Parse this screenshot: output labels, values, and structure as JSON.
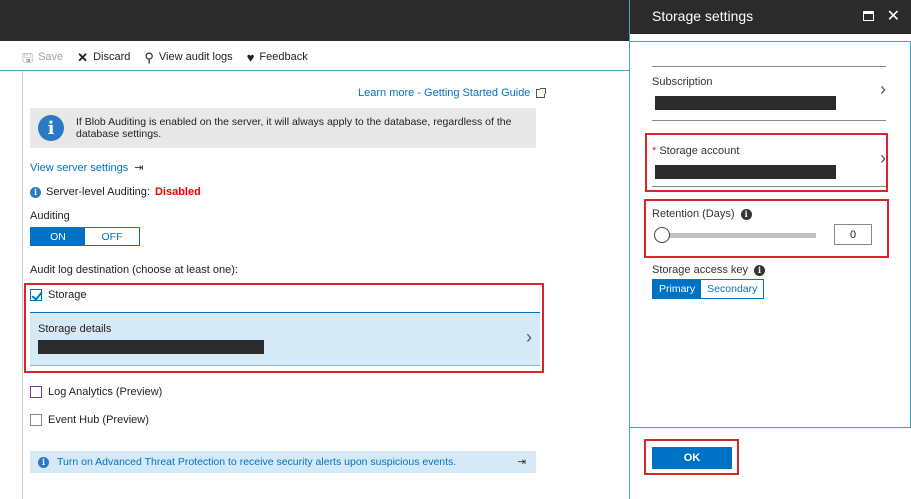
{
  "toolbar": {
    "save": "Save",
    "discard": "Discard",
    "view_audit_logs": "View audit logs",
    "feedback": "Feedback"
  },
  "learn_more": "Learn more - Getting Started Guide",
  "info_text": "If Blob Auditing is enabled on the server, it will always apply to the database, regardless of the database settings.",
  "view_server_settings": "View server settings",
  "server_auditing_label": "Server-level Auditing:",
  "server_auditing_value": "Disabled",
  "auditing": {
    "label": "Auditing",
    "on": "ON",
    "off": "OFF",
    "selected": "ON"
  },
  "destination_label": "Audit log destination (choose at least one):",
  "destinations": {
    "storage": "Storage",
    "storage_details": "Storage details",
    "log_analytics": "Log Analytics (Preview)",
    "event_hub": "Event Hub (Preview)"
  },
  "atp_banner": "Turn on Advanced Threat Protection to receive security alerts upon suspicious events.",
  "panel": {
    "title": "Storage settings",
    "subscription_label": "Subscription",
    "storage_account_label": "Storage account",
    "required_marker": "*",
    "retention_label": "Retention (Days)",
    "retention_value": "0",
    "access_key_label": "Storage access key",
    "key_primary": "Primary",
    "key_secondary": "Secondary",
    "ok": "OK"
  },
  "colors": {
    "accent": "#0072c6",
    "highlight_box": "#d9232e",
    "disabled_text": "#e00000",
    "header_bg": "#2b2b2b"
  }
}
